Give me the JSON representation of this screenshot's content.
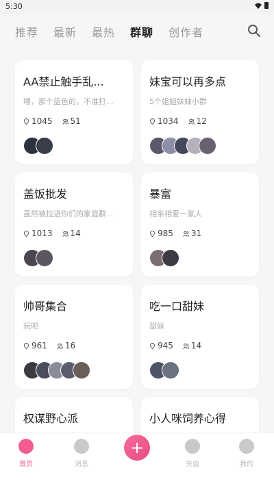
{
  "status_bar": {
    "time": "5:30"
  },
  "tabs": [
    {
      "label": "推荐",
      "active": false
    },
    {
      "label": "最新",
      "active": false
    },
    {
      "label": "最热",
      "active": false
    },
    {
      "label": "群聊",
      "active": true
    },
    {
      "label": "创作者",
      "active": false
    }
  ],
  "groups": [
    {
      "title": "AA禁止触手乱...",
      "desc": "喂，那个蓝色的，不准打...",
      "views": "1045",
      "members": "51",
      "avatar_colors": [
        "#2c3140",
        "#3a3e4a"
      ]
    },
    {
      "title": "妹宝可以再多点",
      "desc": "5个姐姐妹妹小群",
      "views": "1034",
      "members": "12",
      "avatar_colors": [
        "#5c5a6a",
        "#8d8fa6",
        "#44485a",
        "#b4b0bc",
        "#6a6170"
      ]
    },
    {
      "title": "盖饭批发",
      "desc": "虽然被拉进你们的家庭群...",
      "views": "1013",
      "members": "14",
      "avatar_colors": [
        "#4a4550",
        "#5b5660"
      ]
    },
    {
      "title": "暴富",
      "desc": "相亲相爱一家人",
      "views": "985",
      "members": "31",
      "avatar_colors": [
        "#7a6e72",
        "#3e3a44"
      ]
    },
    {
      "title": "帅哥集合",
      "desc": "玩吧",
      "views": "961",
      "members": "16",
      "avatar_colors": [
        "#3a3a40",
        "#4a4d5c",
        "#8a8c98",
        "#5a5e6c",
        "#6b5e58"
      ]
    },
    {
      "title": "吃一口甜妹",
      "desc": "甜妹",
      "views": "945",
      "members": "14",
      "avatar_colors": [
        "#4e5566",
        "#6b7280"
      ]
    },
    {
      "title": "权谋野心派",
      "desc": "",
      "views": "",
      "members": "",
      "avatar_colors": []
    },
    {
      "title": "小人咪饲养心得",
      "desc": "",
      "views": "",
      "members": "",
      "avatar_colors": []
    }
  ],
  "bottom_nav": {
    "home": "首页",
    "messages": "消息",
    "recharge": "充值",
    "mine": "我的",
    "add": "+"
  },
  "colors": {
    "accent": "#f25d8e",
    "background": "#f6f6f7"
  }
}
